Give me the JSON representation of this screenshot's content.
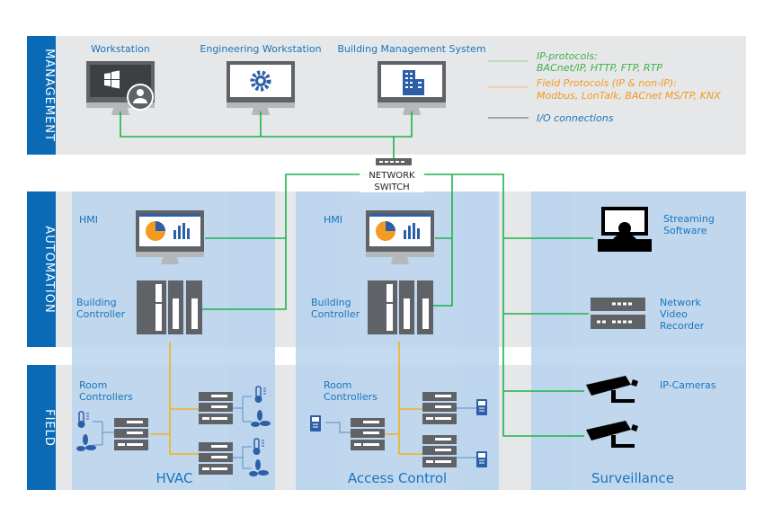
{
  "colors": {
    "ip": "#1db34a",
    "field": "#f2b21b",
    "io": "#5b6770",
    "brand": "#0a6ab5",
    "column": "#b8d4ee",
    "band": "#e6e7e8"
  },
  "bands": {
    "management": "MANAGEMENT",
    "automation": "AUTOMATION",
    "field": "FIELD"
  },
  "management": {
    "workstation": "Workstation",
    "engineering": "Engineering Workstation",
    "bms": "Building Management System"
  },
  "legend": {
    "ip_title": "IP-protocols:",
    "ip_list": "BACnet/IP, HTTP, FTP, RTP",
    "field_title": "Field Protocols (IP & non-IP):",
    "field_list": "Modbus, LonTalk, BACnet MS/TP, KNX",
    "io": "I/O connections"
  },
  "switch": {
    "line1": "NETWORK",
    "line2": "SWITCH"
  },
  "hvac": {
    "hmi": "HMI",
    "bc1": "Building",
    "bc2": "Controller",
    "rc1": "Room",
    "rc2": "Controllers",
    "title": "HVAC"
  },
  "access": {
    "hmi": "HMI",
    "bc1": "Building",
    "bc2": "Controller",
    "rc1": "Room",
    "rc2": "Controllers",
    "title": "Access Control"
  },
  "surveillance": {
    "stream1": "Streaming",
    "stream2": "Software",
    "nvr1": "Network",
    "nvr2": "Video",
    "nvr3": "Recorder",
    "cams": "IP-Cameras",
    "title": "Surveillance"
  }
}
